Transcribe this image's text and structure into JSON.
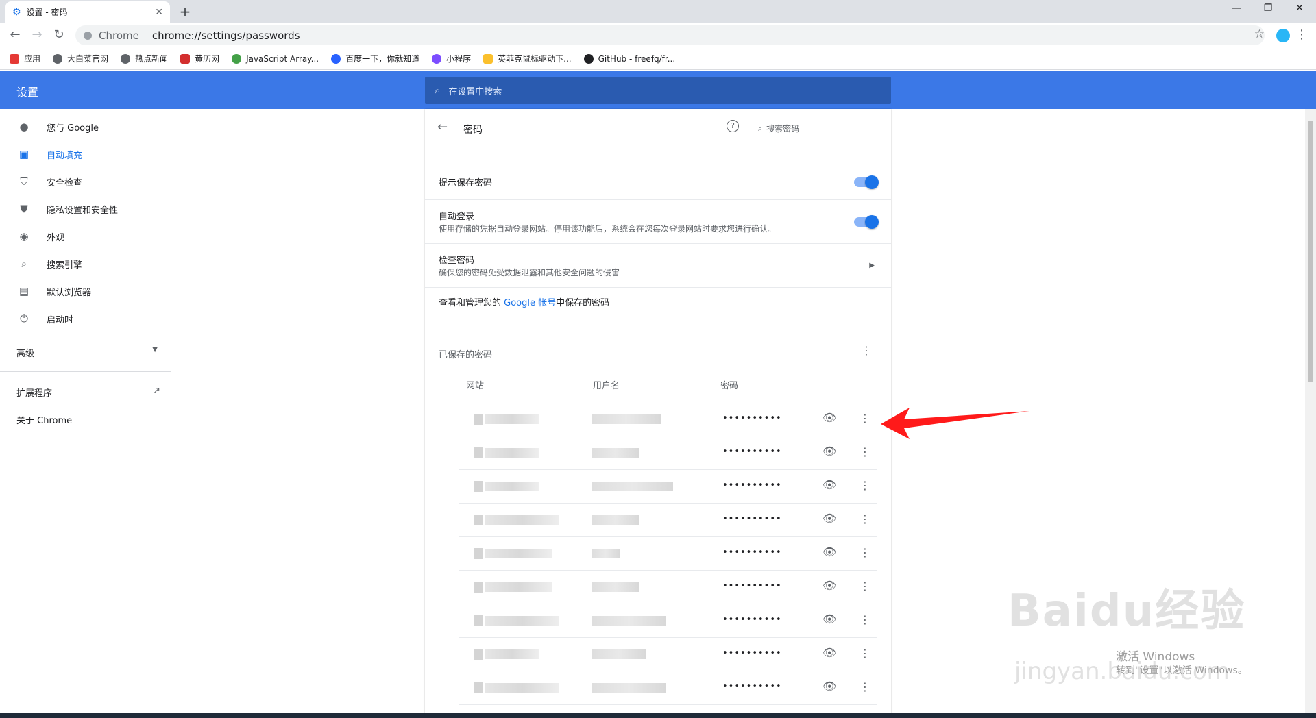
{
  "browser": {
    "tab_title": "设置 - 密码",
    "url_chip": "Chrome",
    "url": "chrome://settings/passwords",
    "bookmarks": [
      {
        "label": "应用",
        "color": "#e53935"
      },
      {
        "label": "大白菜官网",
        "color": "#5f6368"
      },
      {
        "label": "热点新闻",
        "color": "#5f6368"
      },
      {
        "label": "黄历网",
        "color": "#d32f2f"
      },
      {
        "label": "JavaScript Array...",
        "color": "#43a047"
      },
      {
        "label": "百度一下，你就知道",
        "color": "#2962ff"
      },
      {
        "label": "小程序",
        "color": "#7c4dff"
      },
      {
        "label": "英菲克鼠标驱动下...",
        "color": "#fbc02d"
      },
      {
        "label": "GitHub - freefq/fr...",
        "color": "#202124"
      }
    ]
  },
  "header": {
    "title": "设置",
    "search_placeholder": "在设置中搜索"
  },
  "sidebar": {
    "items": [
      {
        "label": "您与 Google",
        "icon": "person-icon"
      },
      {
        "label": "自动填充",
        "icon": "clipboard-icon"
      },
      {
        "label": "安全检查",
        "icon": "shield-check-icon"
      },
      {
        "label": "隐私设置和安全性",
        "icon": "shield-icon"
      },
      {
        "label": "外观",
        "icon": "palette-icon"
      },
      {
        "label": "搜索引擎",
        "icon": "search-icon"
      },
      {
        "label": "默认浏览器",
        "icon": "browser-icon"
      },
      {
        "label": "启动时",
        "icon": "power-icon"
      }
    ],
    "advanced": "高级",
    "extensions": "扩展程序",
    "about": "关于 Chrome"
  },
  "passwords": {
    "title": "密码",
    "search_placeholder": "搜索密码",
    "offer_to_save": "提示保存密码",
    "auto_signin_title": "自动登录",
    "auto_signin_desc": "使用存储的凭据自动登录网站。停用该功能后，系统会在您每次登录网站时要求您进行确认。",
    "check_title": "检查密码",
    "check_desc": "确保您的密码免受数据泄露和其他安全问题的侵害",
    "manage_prefix": "查看和管理您的",
    "manage_link": "Google 帐号",
    "manage_suffix": "中保存的密码",
    "saved_title": "已保存的密码",
    "col_site": "网站",
    "col_user": "用户名",
    "col_pw": "密码",
    "masked": "••••••••••",
    "rows": [
      {
        "site_w": 78,
        "user_w": 100
      },
      {
        "site_w": 78,
        "user_w": 68
      },
      {
        "site_w": 78,
        "user_w": 118
      },
      {
        "site_w": 108,
        "user_w": 68
      },
      {
        "site_w": 98,
        "user_w": 40
      },
      {
        "site_w": 98,
        "user_w": 68
      },
      {
        "site_w": 108,
        "user_w": 108
      },
      {
        "site_w": 78,
        "user_w": 78
      },
      {
        "site_w": 108,
        "user_w": 108
      }
    ]
  },
  "watermark": {
    "brand": "Baidu经验",
    "domain": "jingyan.baidu.com",
    "activate_title": "激活 Windows",
    "activate_desc": "转到\"设置\"以激活 Windows。"
  }
}
